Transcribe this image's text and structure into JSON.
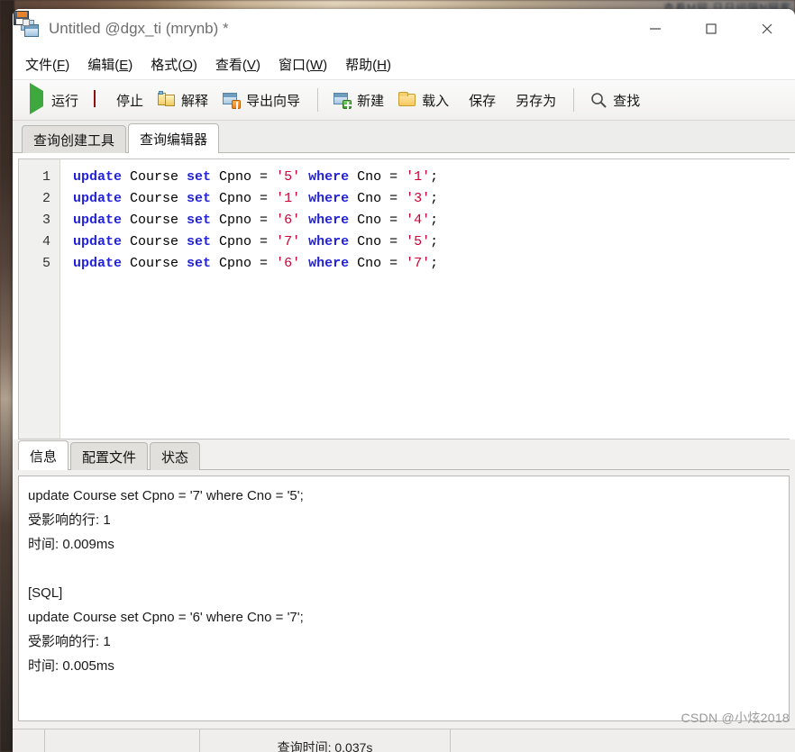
{
  "window": {
    "title": "Untitled @dgx_ti (mrynb) *",
    "icon": "database-window-icon",
    "controls": {
      "minimize": "minimize-icon",
      "maximize": "maximize-icon",
      "close": "close-icon"
    }
  },
  "desktop": {
    "taskbar_text": "查看M网  日日间隔N网客"
  },
  "menu": {
    "items": [
      {
        "label": "文件",
        "mnemonic": "F"
      },
      {
        "label": "编辑",
        "mnemonic": "E"
      },
      {
        "label": "格式",
        "mnemonic": "O"
      },
      {
        "label": "查看",
        "mnemonic": "V"
      },
      {
        "label": "窗口",
        "mnemonic": "W"
      },
      {
        "label": "帮助",
        "mnemonic": "H"
      }
    ]
  },
  "toolbar": {
    "buttons": [
      {
        "label": "运行",
        "icon": "run-icon"
      },
      {
        "label": "停止",
        "icon": "stop-icon"
      },
      {
        "label": "解释",
        "icon": "explain-icon"
      },
      {
        "label": "导出向导",
        "icon": "export-wizard-icon"
      },
      {
        "label": "新建",
        "icon": "new-query-icon"
      },
      {
        "label": "载入",
        "icon": "open-folder-icon"
      },
      {
        "label": "保存",
        "icon": "save-icon"
      },
      {
        "label": "另存为",
        "icon": "save-as-icon"
      },
      {
        "label": "查找",
        "icon": "search-icon"
      }
    ]
  },
  "tabs": {
    "items": [
      {
        "label": "查询创建工具",
        "active": false
      },
      {
        "label": "查询编辑器",
        "active": true
      }
    ]
  },
  "editor": {
    "line_numbers": [
      "1",
      "2",
      "3",
      "4",
      "5"
    ],
    "lines": [
      {
        "kw1": "update",
        "table": " Course ",
        "kw2": "set",
        "col": " Cpno = ",
        "val": "'5'",
        "kw3": " where",
        "col2": " Cno = ",
        "val2": "'1'",
        "end": ";"
      },
      {
        "kw1": "update",
        "table": " Course ",
        "kw2": "set",
        "col": " Cpno = ",
        "val": "'1'",
        "kw3": " where",
        "col2": " Cno = ",
        "val2": "'3'",
        "end": ";"
      },
      {
        "kw1": "update",
        "table": " Course ",
        "kw2": "set",
        "col": " Cpno = ",
        "val": "'6'",
        "kw3": " where",
        "col2": " Cno = ",
        "val2": "'4'",
        "end": ";"
      },
      {
        "kw1": "update",
        "table": " Course ",
        "kw2": "set",
        "col": " Cpno = ",
        "val": "'7'",
        "kw3": " where",
        "col2": " Cno = ",
        "val2": "'5'",
        "end": ";"
      },
      {
        "kw1": "update",
        "table": " Course ",
        "kw2": "set",
        "col": " Cpno = ",
        "val": "'6'",
        "kw3": " where",
        "col2": " Cno = ",
        "val2": "'7'",
        "end": ";"
      }
    ],
    "colors": {
      "keyword": "#2222dd",
      "string": "#cc0033",
      "identifier": "#000000",
      "gutter_bg": "#f0f0ee"
    }
  },
  "result": {
    "tabs": [
      {
        "label": "信息",
        "active": true
      },
      {
        "label": "配置文件",
        "active": false
      },
      {
        "label": "状态",
        "active": false
      }
    ],
    "messages": [
      "update Course set Cpno = '7' where Cno = '5';",
      "受影响的行: 1",
      "时间: 0.009ms",
      "",
      "[SQL]",
      "update Course set Cpno = '6' where Cno = '7';",
      "受影响的行: 1",
      "时间: 0.005ms"
    ]
  },
  "status_bar": {
    "cells": [
      "",
      "",
      "查询时间: 0.037s",
      ""
    ]
  },
  "watermark": {
    "text": "CSDN @小炫2018"
  }
}
